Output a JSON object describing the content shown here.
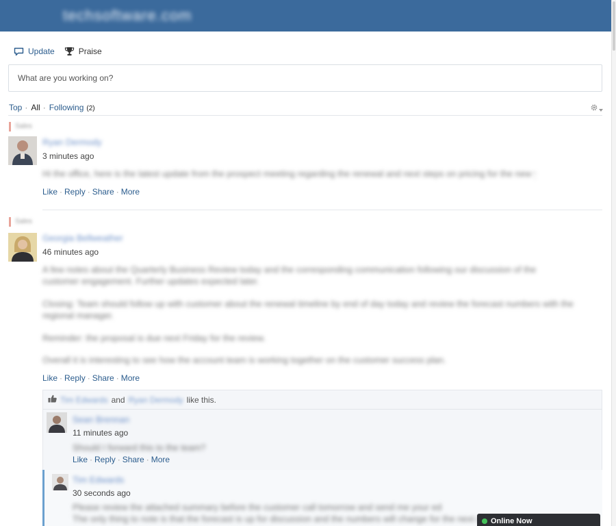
{
  "header": {
    "brand": "techsoftware.com"
  },
  "publisher": {
    "tabs": [
      {
        "label": "Update",
        "icon": "speech-bubble-icon"
      },
      {
        "label": "Praise",
        "icon": "trophy-icon"
      }
    ],
    "placeholder": "What are you working on?"
  },
  "feed_filters": {
    "top": "Top",
    "all": "All",
    "following": "Following",
    "following_count": "(2)"
  },
  "posts": [
    {
      "group": "Sales",
      "author": "Ryan Dermody",
      "time": "3 minutes ago",
      "body": [
        "Hi the office, here is the latest update from the prospect meeting regarding the renewal and next steps on pricing for the new year"
      ],
      "actions": [
        "Like",
        "Reply",
        "Share",
        "More"
      ]
    },
    {
      "group": "Sales",
      "author": "Georgia Bellweather",
      "time": "46 minutes ago",
      "body": [
        "A few notes about the Quarterly Business Review today and the corresponding communication following our discussion of the customer engagement. Further updates expected later.",
        "Closing: Team should follow up with customer about the renewal timeline by end of day today and review the forecast numbers with the regional manager.",
        "Reminder: the proposal is due next Friday for the review.",
        "Overall it is interesting to see how the account team is working together on the customer success plan."
      ],
      "actions": [
        "Like",
        "Reply",
        "Share",
        "More"
      ],
      "likes": {
        "names": [
          "Tim Edwards",
          "Ryan Dermody"
        ],
        "and": "and",
        "suffix": "like this."
      },
      "replies": [
        {
          "author": "Sean Brennan",
          "time": "11 minutes ago",
          "body": "Should I forward this to the team?",
          "actions": [
            "Like",
            "Reply",
            "Share",
            "More"
          ]
        },
        {
          "author": "Tim Edwards",
          "time": "30 seconds ago",
          "body": [
            "Please review the attached summary before the customer call tomorrow and send me your edits.",
            "The only thing to note is that the forecast is up for discussion and the numbers will change for the next quarter."
          ]
        }
      ]
    }
  ],
  "online_now": {
    "label": "Online Now"
  }
}
